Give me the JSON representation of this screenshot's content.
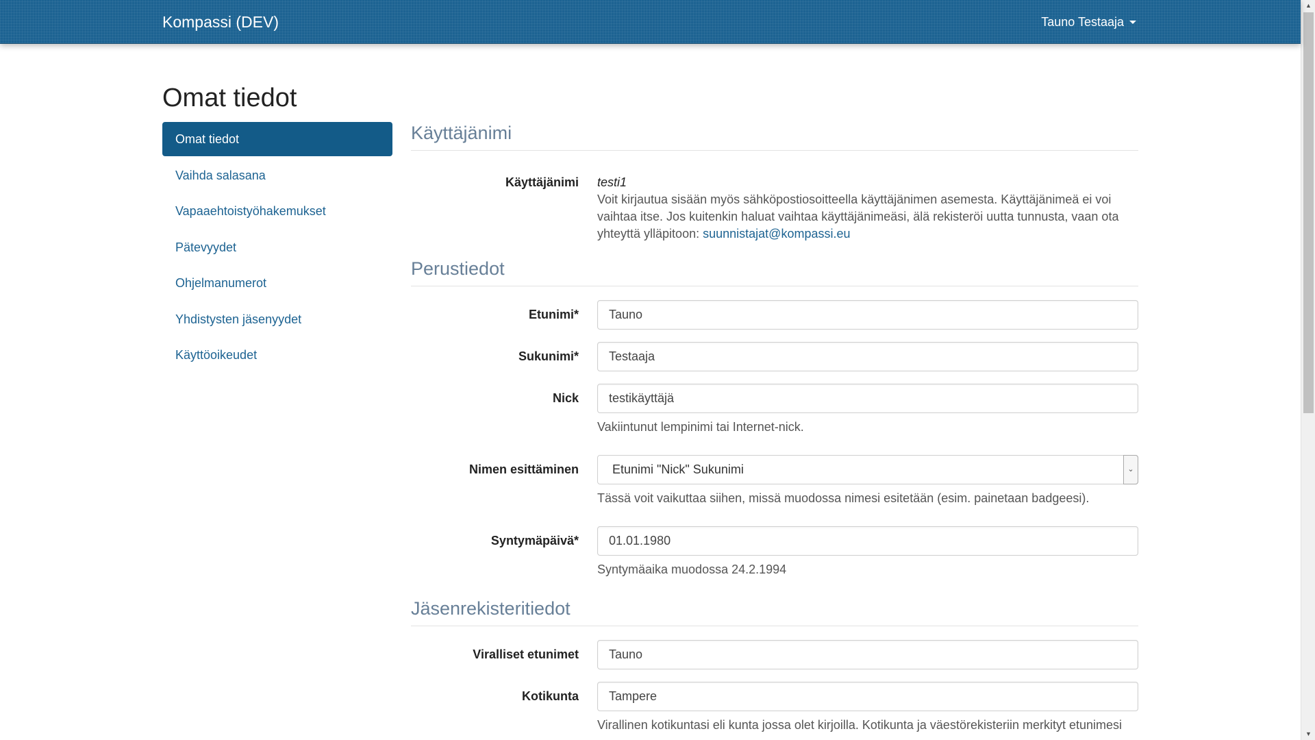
{
  "navbar": {
    "brand": "Kompassi (DEV)",
    "user_name": "Tauno Testaaja"
  },
  "page": {
    "title": "Omat tiedot"
  },
  "sidebar": {
    "items": [
      {
        "label": "Omat tiedot",
        "active": true
      },
      {
        "label": "Vaihda salasana"
      },
      {
        "label": "Vapaaehtoistyöhakemukset"
      },
      {
        "label": "Pätevyydet"
      },
      {
        "label": "Ohjelmanumerot"
      },
      {
        "label": "Yhdistysten jäsenyydet"
      },
      {
        "label": "Käyttöoikeudet"
      }
    ]
  },
  "username_section": {
    "heading": "Käyttäjänimi",
    "label": "Käyttäjänimi",
    "value": "testi1",
    "help": "Voit kirjautua sisään myös sähköpostiosoitteella käyttäjänimen asemesta. Käyttäjänimeä ei voi vaihtaa itse. Jos kuitenkin haluat vaihtaa käyttäjänimeäsi, älä rekisteröi uutta tunnusta, vaan ota yhteyttä ylläpitoon:",
    "email": "suunnistajat@kompassi.eu"
  },
  "basic_section": {
    "heading": "Perustiedot",
    "first_name": {
      "label": "Etunimi*",
      "value": "Tauno"
    },
    "surname": {
      "label": "Sukunimi*",
      "value": "Testaaja"
    },
    "nick": {
      "label": "Nick",
      "value": "testikäyttäjä",
      "help": "Vakiintunut lempinimi tai Internet-nick."
    },
    "name_display": {
      "label": "Nimen esittäminen",
      "value": "Etunimi \"Nick\" Sukunimi",
      "help": "Tässä voit vaikuttaa siihen, missä muodossa nimesi esitetään (esim. painetaan badgeesi)."
    },
    "birth_date": {
      "label": "Syntymäpäivä*",
      "value": "01.01.1980",
      "help": "Syntymäaika muodossa 24.2.1994"
    }
  },
  "member_section": {
    "heading": "Jäsenrekisteritiedot",
    "official_first_names": {
      "label": "Viralliset etunimet",
      "value": "Tauno"
    },
    "municipality": {
      "label": "Kotikunta",
      "value": "Tampere",
      "help": "Virallinen kotikuntasi eli kunta jossa olet kirjoilla. Kotikunta ja väestörekisteriin merkityt etunimesi"
    }
  }
}
